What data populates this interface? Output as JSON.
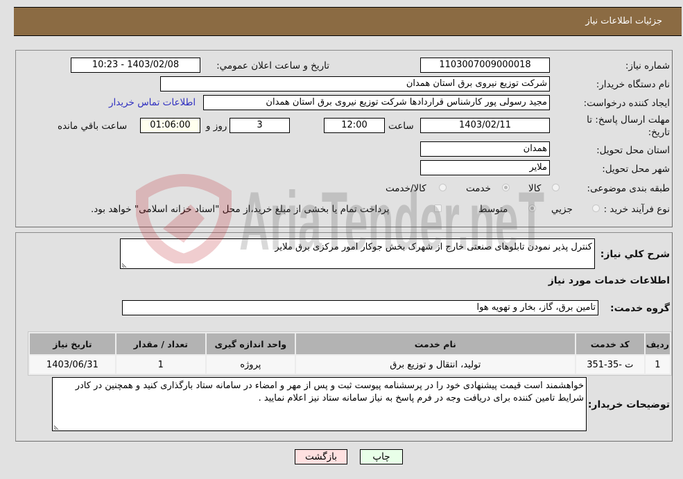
{
  "header": {
    "title": "جزئيات اطلاعات نياز"
  },
  "details": {
    "need_number_label": "شماره نیاز:",
    "need_number": "1103007009000018",
    "announce_label": "تاريخ و ساعت اعلان عمومي:",
    "announce_value": "1403/02/08 - 10:23",
    "buyer_org_label": "نام دستگاه خریدار:",
    "buyer_org": "شرکت توزیع نیروی برق استان همدان",
    "creator_label": "ایجاد کننده درخواست:",
    "creator": "مجید رسولی پور کارشناس قراردادها شرکت توزیع نیروی برق استان همدان",
    "contact_link": "اطلاعات تماس خریدار",
    "deadline_label": "مهلت ارسال پاسخ: تا تاریخ:",
    "deadline_date": "1403/02/11",
    "time_label": "ساعت",
    "deadline_time": "12:00",
    "days_value": "3",
    "days_label": "روز و",
    "remaining_time": "01:06:00",
    "remaining_label": "ساعت باقي مانده",
    "province_label": "استان محل تحویل:",
    "province": "همدان",
    "city_label": "شهر محل تحویل:",
    "city": "ملایر",
    "category_label": "طبقه بندی موضوعی:",
    "category_options": [
      {
        "label": "کالا",
        "checked": false
      },
      {
        "label": "خدمت",
        "checked": true
      },
      {
        "label": "کالا/خدمت",
        "checked": false
      }
    ],
    "process_label": "نوع فرآیند خرید :",
    "process_options": [
      {
        "label": "جزيي",
        "checked": false
      },
      {
        "label": "متوسط",
        "checked": true
      }
    ],
    "treasury_note": "پرداخت تمام یا بخشی از مبلغ خرید،از محل \"اسناد خزانه اسلامی\" خواهد بود.",
    "treasury_checked": false
  },
  "description": {
    "label": "شرح کلي نياز:",
    "value": "کنترل پذیر نمودن تابلوهای صنعتی خارج از شهرک بخش جوکار امور مرکزی برق ملایر"
  },
  "services": {
    "section_title": "اطلاعات خدمات مورد نیاز",
    "group_label": "گروه خدمت:",
    "group_value": "تامین برق، گاز، بخار و تهویه هوا",
    "columns": [
      "ردیف",
      "کد خدمت",
      "نام خدمت",
      "واحد اندازه گیری",
      "تعداد / مقدار",
      "تاریخ نیاز"
    ],
    "rows": [
      [
        "1",
        "ت -35-351",
        "تولید، انتقال و توزیع برق",
        "پروژه",
        "1",
        "1403/06/31"
      ]
    ]
  },
  "buyer_notes": {
    "label": "توضیحات خریدار:",
    "value": "خواهشمند است  قیمت پیشنهادی خود را در پرسشنامه پیوست ثبت و پس از مهر و امضاء در سامانه ستاد بارگذاری کنید  و همچنین  در کادر شرایط تامین کننده برای دریافت وجه در فرم پاسخ به نیاز سامانه ستاد نیز اعلام نمایید ."
  },
  "buttons": {
    "print": "چاپ",
    "back": "بازگشت"
  },
  "watermark": {
    "text": "AriaTender.neT"
  }
}
